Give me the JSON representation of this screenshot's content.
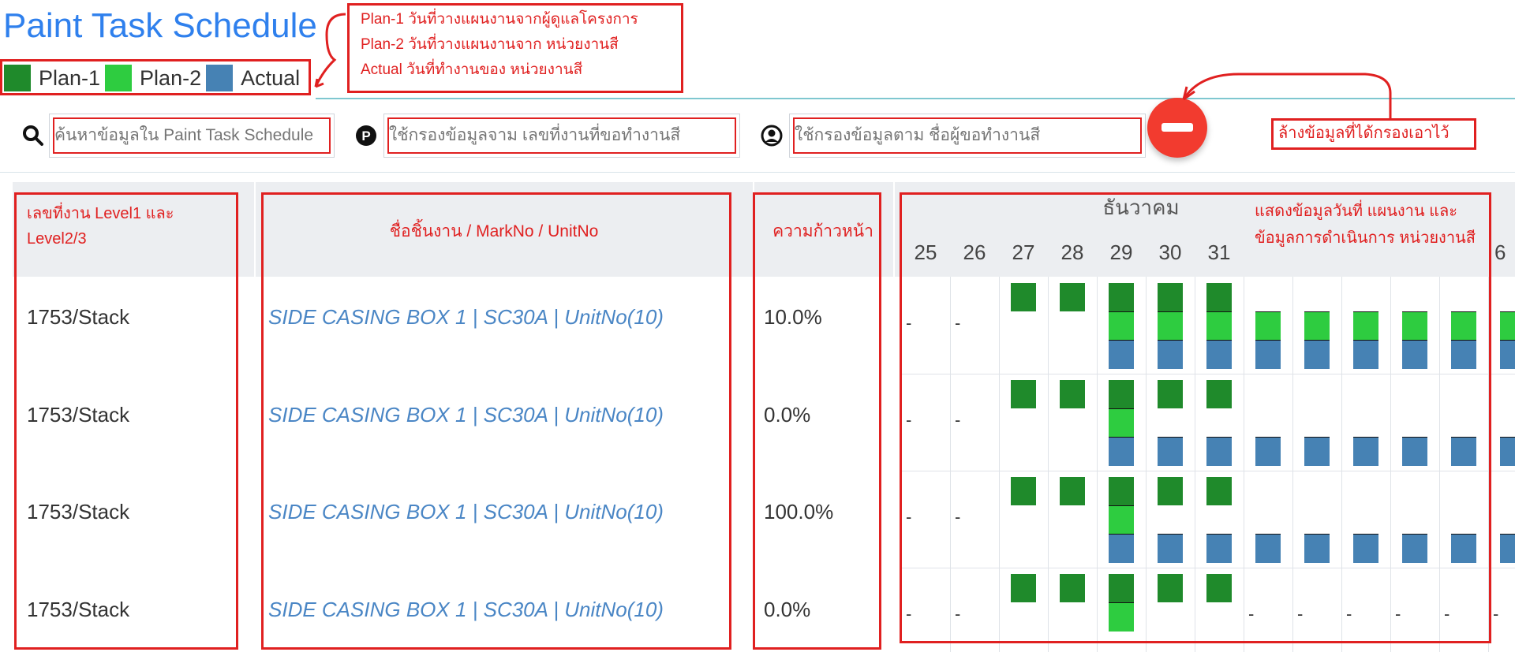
{
  "page": {
    "title": "Paint Task Schedule"
  },
  "legend": [
    {
      "label": "Plan-1",
      "color": "#1f8a2b"
    },
    {
      "label": "Plan-2",
      "color": "#2ecc40"
    },
    {
      "label": "Actual",
      "color": "#4682b4"
    }
  ],
  "annotations": {
    "legend_note": [
      "Plan-1 วันที่วางแผนงานจากผู้ดูแลโครงการ",
      "Plan-2 วันที่วางแผนงานจาก หน่วยงานสี",
      "Actual วันที่ทำงานของ หน่วยงานสี"
    ],
    "clear_note": "ล้างข้อมูลที่ได้กรองเอาไว้",
    "chart_note": "แสดงข้อมูลวันที่ แผนงาน และข้อมูลการดำเนินการ หน่วยงานสี"
  },
  "filters": {
    "search_placeholder": "ค้นหาข้อมูลใน Paint Task Schedule",
    "job_placeholder": "ใช้กรองข้อมูลจาม เลขที่งานที่ขอทำงานสี",
    "user_placeholder": "ใช้กรองข้อมูลตาม ชื่อผู้ขอทำงานสี"
  },
  "table": {
    "headers": {
      "job": "เลขที่งาน Level1 และ Level2/3",
      "name": "ชื่อชิ้นงาน / MarkNo / UnitNo",
      "progress": "ความก้าวหน้า",
      "month": "ธันวาคม"
    },
    "days": [
      "25",
      "26",
      "27",
      "28",
      "29",
      "30",
      "31",
      "6"
    ],
    "rows": [
      {
        "job": "1753/Stack",
        "name": "SIDE CASING BOX 1 | SC30A | UnitNo(10)",
        "progress": "10.0%"
      },
      {
        "job": "1753/Stack",
        "name": "SIDE CASING BOX 1 | SC30A | UnitNo(10)",
        "progress": "0.0%"
      },
      {
        "job": "1753/Stack",
        "name": "SIDE CASING BOX 1 | SC30A | UnitNo(10)",
        "progress": "100.0%"
      },
      {
        "job": "1753/Stack",
        "name": "SIDE CASING BOX 1 | SC30A | UnitNo(10)",
        "progress": "0.0%"
      }
    ],
    "empty_marker": "-"
  },
  "colors": {
    "title": "#2f80ed",
    "annotation": "#e02020",
    "plan1": "#1f8a2b",
    "plan2": "#2ecc40",
    "actual": "#4682b4",
    "clear_button": "#f23b2f"
  }
}
